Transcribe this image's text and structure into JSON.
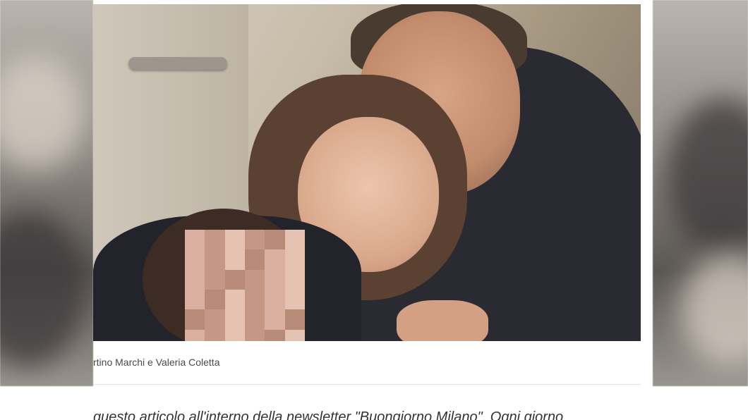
{
  "article": {
    "photo_caption": "rtino Marchi e Valeria Coletta",
    "body_text": "questo articolo all'interno della newsletter \"Buongiorno Milano\". Ogni giorno"
  },
  "colors": {
    "caption_text": "#4a4a4a",
    "body_text": "#333333",
    "divider": "#e3e3e3"
  }
}
